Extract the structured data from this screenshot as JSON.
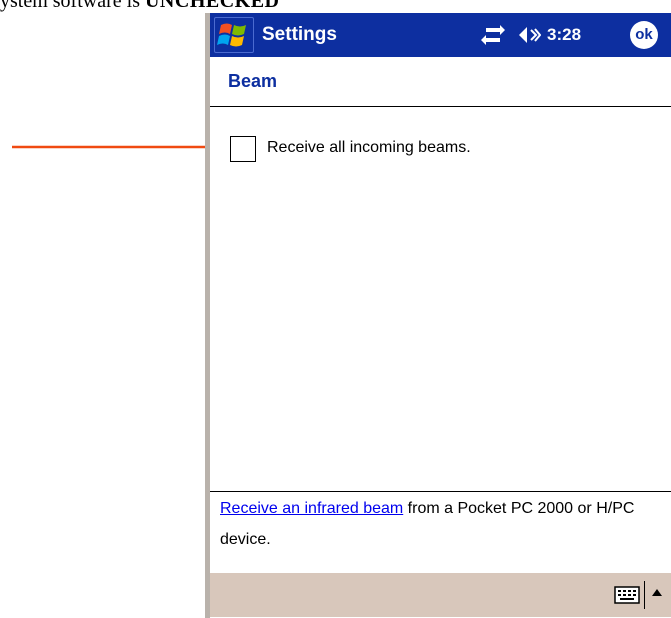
{
  "document": {
    "text_before": "ystem software is ",
    "text_emphasis": "UNCHECKED"
  },
  "colors": {
    "titlebar": "#0d2fa0",
    "arrow": "#f04a12",
    "link": "#0000ee",
    "bottombar": "#d8c7bb"
  },
  "titlebar": {
    "start_icon": "windows-flag-icon",
    "app_title": "Settings",
    "connectivity_icon": "connectivity-icon",
    "volume_icon": "speaker-icon",
    "time": "3:28",
    "ok_label": "ok"
  },
  "page": {
    "title": "Beam",
    "checkbox": {
      "label": "Receive all incoming beams.",
      "checked": false
    }
  },
  "info": {
    "link_text": "Receive an infrared beam",
    "text_after": " from a Pocket PC 2000 or H/PC device."
  },
  "bottombar": {
    "keyboard_icon": "keyboard-icon",
    "input_menu_icon": "up-arrow-icon"
  }
}
